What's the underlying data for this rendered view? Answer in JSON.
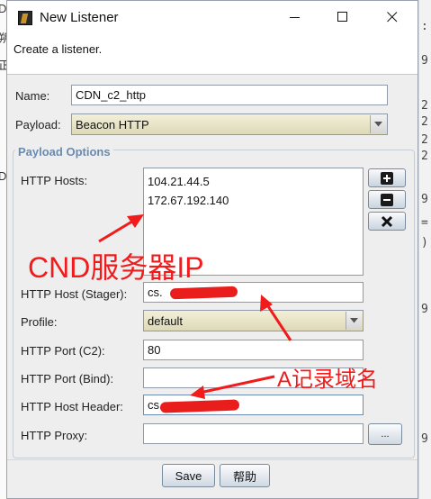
{
  "background": {
    "left_fragments": [
      "D",
      "朔",
      "正",
      "D"
    ],
    "right_fragments": [
      ":",
      "9",
      "2",
      "2",
      "2",
      "2",
      "9",
      "=",
      ")",
      "9",
      "9"
    ]
  },
  "window": {
    "title": "New Listener",
    "description": "Create a listener."
  },
  "form": {
    "name_label": "Name:",
    "name_value": "CDN_c2_http",
    "payload_label": "Payload:",
    "payload_value": "Beacon HTTP"
  },
  "payload_options": {
    "group_title": "Payload Options",
    "http_hosts_label": "HTTP Hosts:",
    "http_hosts": [
      "104.21.44.5",
      "172.67.192.140"
    ],
    "host_stager_label": "HTTP Host (Stager):",
    "host_stager_value": "cs.",
    "profile_label": "Profile:",
    "profile_value": "default",
    "port_c2_label": "HTTP Port (C2):",
    "port_c2_value": "80",
    "port_bind_label": "HTTP Port (Bind):",
    "port_bind_value": "",
    "host_header_label": "HTTP Host Header:",
    "host_header_value": "cs.",
    "proxy_label": "HTTP Proxy:",
    "proxy_value": "",
    "proxy_button": "..."
  },
  "buttons": {
    "save": "Save",
    "help": "帮助"
  },
  "annotations": {
    "cdn_ip": "CND服务器IP",
    "a_record": "A记录域名",
    "color": "#f11b1b"
  }
}
